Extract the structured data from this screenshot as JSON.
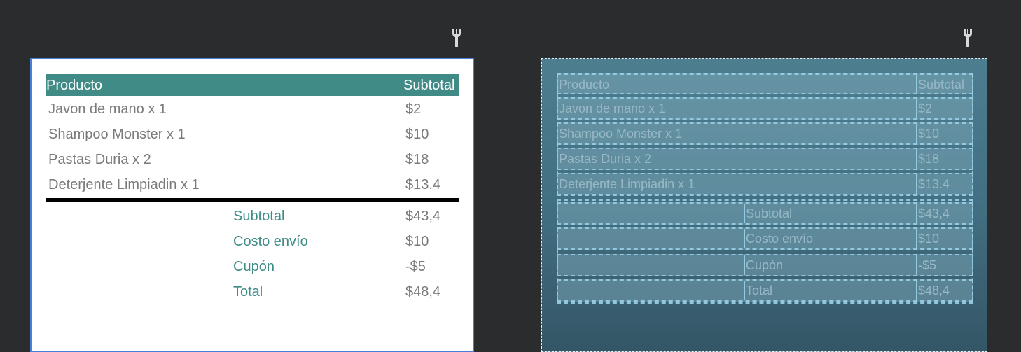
{
  "table": {
    "header": {
      "product": "Producto",
      "subtotal": "Subtotal"
    },
    "items": [
      {
        "name": "Javon de mano x 1",
        "price": "$2"
      },
      {
        "name": "Shampoo Monster x 1",
        "price": "$10"
      },
      {
        "name": "Pastas Duria x 2",
        "price": "$18"
      },
      {
        "name": "Deterjente Limpiadin x 1",
        "price": "$13.4"
      }
    ],
    "summary": [
      {
        "label": "Subtotal",
        "value": "$43,4"
      },
      {
        "label": "Costo envío",
        "value": "$10"
      },
      {
        "label": "Cupón",
        "value": "-$5"
      },
      {
        "label": "Total",
        "value": "$48,4"
      }
    ]
  },
  "toolbar": {
    "design_icon": "wrench-icon",
    "blueprint_icon": "wrench-icon"
  },
  "colors": {
    "background": "#2b2c2e",
    "header": "#418b86",
    "accent": "#3e8c87",
    "selection": "#4a7fd8",
    "blueprint": "#4d7e90"
  }
}
